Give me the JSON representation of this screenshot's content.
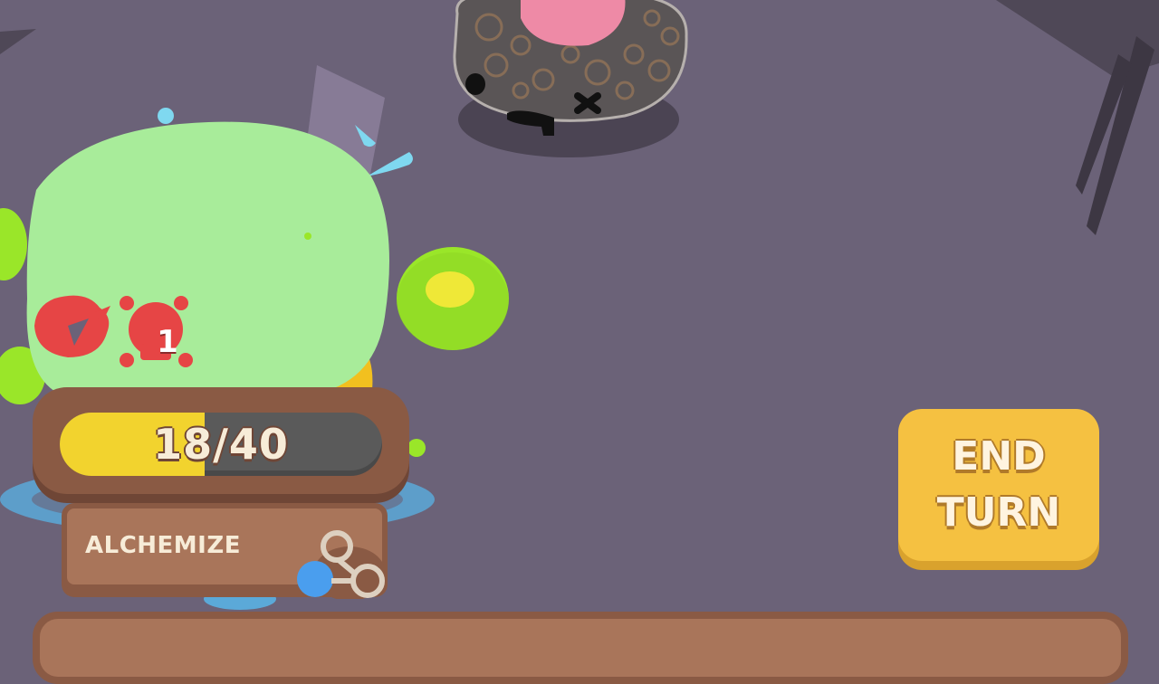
{
  "player": {
    "hp_current": 18,
    "hp_max": 40,
    "hp_text": "18/40",
    "hp_fraction": 0.45,
    "status_effect_count": "1"
  },
  "actions": {
    "alchemize_label": "ALCHEMIZE",
    "end_turn_line1": "END",
    "end_turn_line2": "TURN"
  },
  "colors": {
    "background": "#6b6278",
    "hp_fill": "#f2d32e",
    "panel_brown": "#8a5a44",
    "end_turn_yellow": "#f5c141",
    "slime_green": "#a8ec9a",
    "status_red": "#e64545"
  },
  "icons": {
    "status_icons": [
      "broken-heart-icon",
      "skull-icon"
    ],
    "alchemize_icon": "molecule-icon"
  }
}
